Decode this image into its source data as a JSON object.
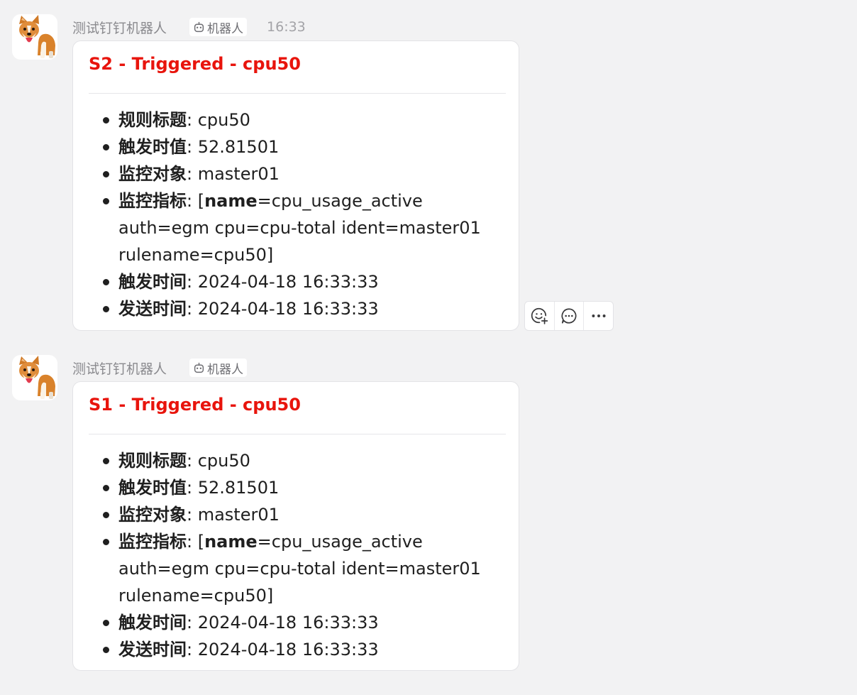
{
  "messages": [
    {
      "sender": "测试钉钉机器人",
      "badge": "机器人",
      "time": "16:33",
      "title": "S2 - Triggered - cpu50",
      "fields": [
        {
          "label": "规则标题",
          "sep": ": ",
          "value": "cpu50"
        },
        {
          "label": "触发时值",
          "sep": ": ",
          "value": "52.81501"
        },
        {
          "label": "监控对象",
          "sep": ": ",
          "value": "master01"
        },
        {
          "label": "监控指标",
          "sep": ": [",
          "bold": "name",
          "value": "=cpu_usage_active auth=egm cpu=cpu-total ident=master01 rulename=cpu50]"
        },
        {
          "label": "触发时间",
          "sep": ": ",
          "value": "2024-04-18 16:33:33"
        },
        {
          "label": "发送时间",
          "sep": ": ",
          "value": "2024-04-18 16:33:33"
        }
      ]
    },
    {
      "sender": "测试钉钉机器人",
      "badge": "机器人",
      "title": "S1 - Triggered - cpu50",
      "fields": [
        {
          "label": "规则标题",
          "sep": ": ",
          "value": "cpu50"
        },
        {
          "label": "触发时值",
          "sep": ": ",
          "value": "52.81501"
        },
        {
          "label": "监控对象",
          "sep": ": ",
          "value": "master01"
        },
        {
          "label": "监控指标",
          "sep": ": [",
          "bold": "name",
          "value": "=cpu_usage_active auth=egm cpu=cpu-total ident=master01 rulename=cpu50]"
        },
        {
          "label": "触发时间",
          "sep": ": ",
          "value": "2024-04-18 16:33:33"
        },
        {
          "label": "发送时间",
          "sep": ": ",
          "value": "2024-04-18 16:33:33"
        }
      ]
    }
  ],
  "actions": {
    "icons": [
      "add-reaction-icon",
      "reply-icon",
      "more-icon"
    ]
  },
  "colors": {
    "background": "#f2f2f3",
    "title": "#e8140c",
    "text": "#1f1f1f",
    "meta": "#8a8a8e"
  }
}
